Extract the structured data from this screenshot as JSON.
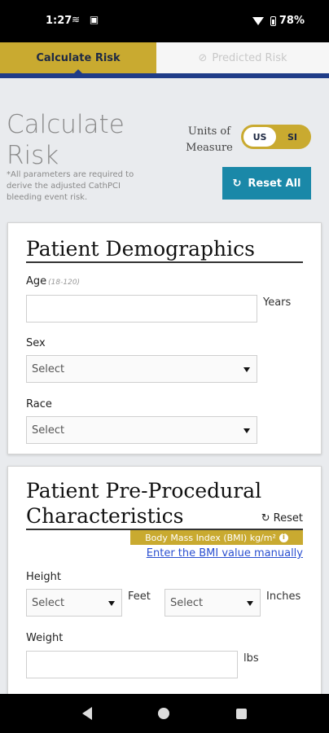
{
  "status": {
    "time": "1:27",
    "left_icons": "≋ ▣",
    "battery": "78%"
  },
  "tabs": {
    "active": "Calculate Risk",
    "inactive": "Predicted Risk"
  },
  "header": {
    "title_line1": "Calculate",
    "title_line2": "Risk",
    "note": "*All parameters are required to derive the adjusted CathPCI bleeding event risk.",
    "units_label": "Units of Measure",
    "unit_us": "US",
    "unit_si": "SI",
    "reset_all": "Reset All"
  },
  "demographics": {
    "title": "Patient Demographics",
    "age_label": "Age",
    "age_hint": "(18-120)",
    "age_value": "",
    "age_unit": "Years",
    "sex_label": "Sex",
    "sex_value": "Select",
    "race_label": "Race",
    "race_value": "Select"
  },
  "preprocedural": {
    "title_line1": "Patient Pre-Procedural",
    "title_line2": "Characteristics",
    "reset": "Reset",
    "bmi_label": "Body Mass Index (BMI) kg/m²",
    "bmi_link": "Enter the BMI value manually",
    "height_label": "Height",
    "feet_value": "Select",
    "feet_unit": "Feet",
    "inches_value": "Select",
    "inches_unit": "Inches",
    "weight_label": "Weight",
    "weight_value": "",
    "weight_unit": "lbs"
  },
  "colors": {
    "gold": "#c9aa30",
    "navy": "#1f3c88",
    "teal": "#1a88a8",
    "link": "#2a4fd0"
  }
}
